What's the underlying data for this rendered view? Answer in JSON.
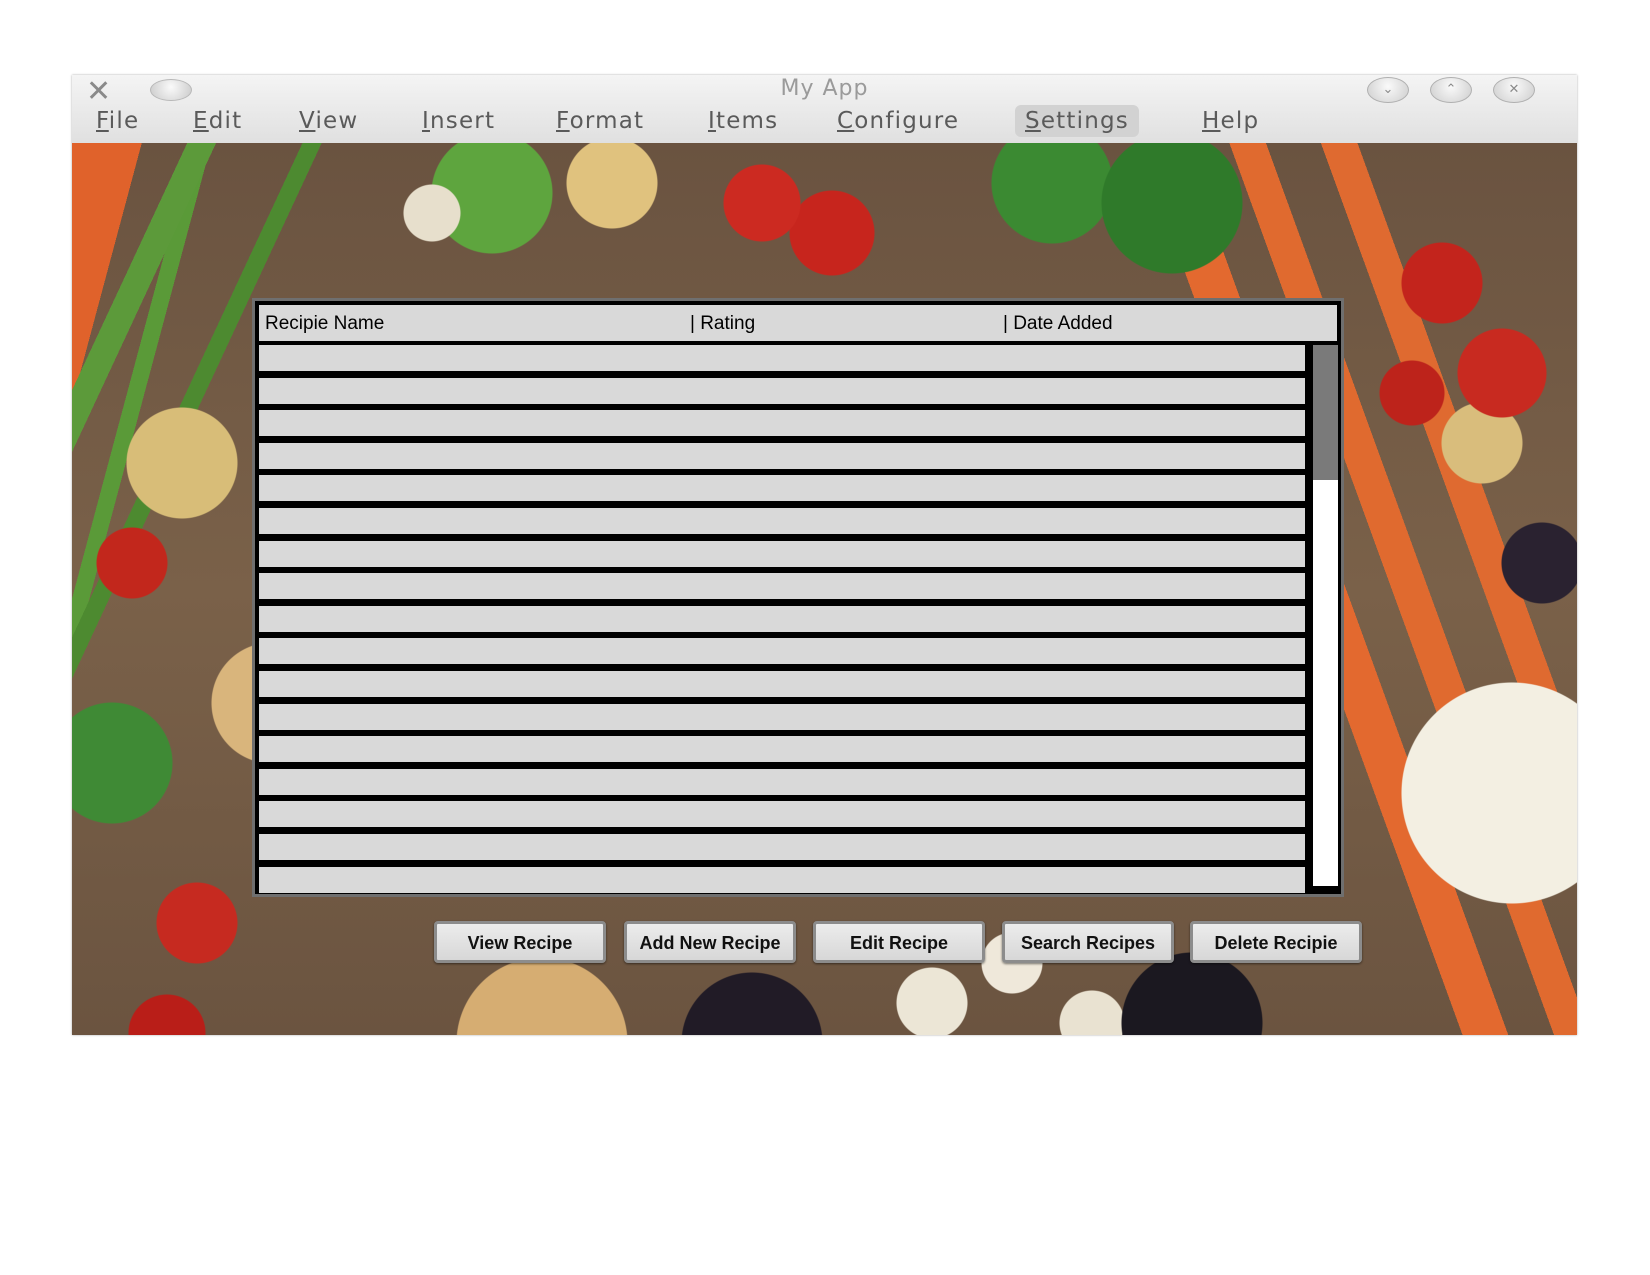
{
  "window": {
    "title": "My App",
    "app_icon": "x-logo-icon",
    "controls": [
      "minimize-icon",
      "maximize-icon",
      "close-icon"
    ]
  },
  "menu": {
    "items": [
      "File",
      "Edit",
      "View",
      "Insert",
      "Format",
      "Items",
      "Configure",
      "Settings",
      "Help"
    ],
    "active": "Settings"
  },
  "table": {
    "columns": [
      "Recipie Name",
      "| Rating",
      "| Date Added"
    ],
    "rows": [
      {
        "name": "",
        "rating": "",
        "date": ""
      },
      {
        "name": "",
        "rating": "",
        "date": ""
      },
      {
        "name": "",
        "rating": "",
        "date": ""
      },
      {
        "name": "",
        "rating": "",
        "date": ""
      },
      {
        "name": "",
        "rating": "",
        "date": ""
      },
      {
        "name": "",
        "rating": "",
        "date": ""
      },
      {
        "name": "",
        "rating": "",
        "date": ""
      },
      {
        "name": "",
        "rating": "",
        "date": ""
      },
      {
        "name": "",
        "rating": "",
        "date": ""
      },
      {
        "name": "",
        "rating": "",
        "date": ""
      },
      {
        "name": "",
        "rating": "",
        "date": ""
      },
      {
        "name": "",
        "rating": "",
        "date": ""
      },
      {
        "name": "",
        "rating": "",
        "date": ""
      },
      {
        "name": "",
        "rating": "",
        "date": ""
      },
      {
        "name": "",
        "rating": "",
        "date": ""
      },
      {
        "name": "",
        "rating": "",
        "date": ""
      },
      {
        "name": "",
        "rating": "",
        "date": ""
      }
    ]
  },
  "buttons": {
    "view": "View Recipe",
    "add": "Add New Recipe",
    "edit": "Edit Recipe",
    "search": "Search Recipes",
    "delete": "Delete Recipie"
  },
  "background": "vegetables-photo"
}
